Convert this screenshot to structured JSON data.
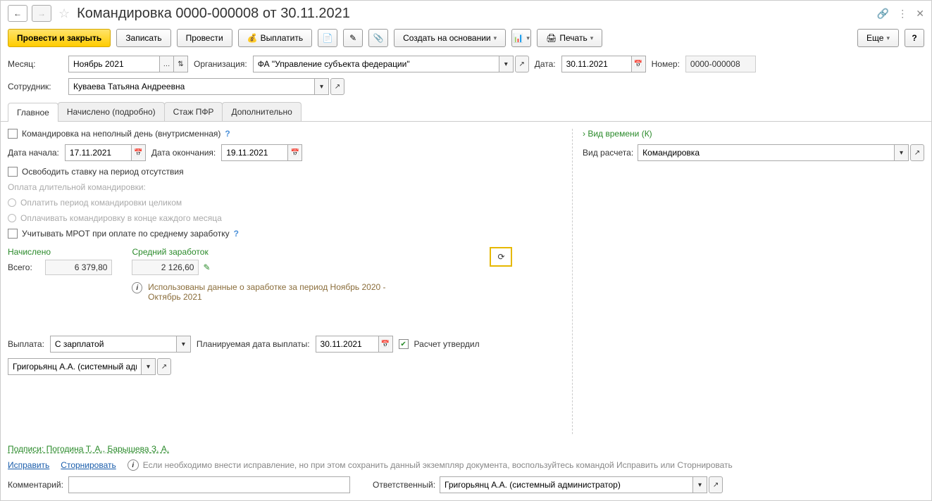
{
  "title": "Командировка 0000-000008 от 30.11.2021",
  "toolbar": {
    "post_close": "Провести и закрыть",
    "save": "Записать",
    "post": "Провести",
    "pay": "Выплатить",
    "create_based": "Создать на основании",
    "print": "Печать",
    "more": "Еще"
  },
  "fields": {
    "month_label": "Месяц:",
    "month_value": "Ноябрь 2021",
    "org_label": "Организация:",
    "org_value": "ФА \"Управление субъекта федерации\"",
    "date_label": "Дата:",
    "date_value": "30.11.2021",
    "number_label": "Номер:",
    "number_value": "0000-000008",
    "employee_label": "Сотрудник:",
    "employee_value": "Куваева Татьяна Андреевна"
  },
  "tabs": {
    "main": "Главное",
    "detail": "Начислено (подробно)",
    "pfr": "Стаж ПФР",
    "extra": "Дополнительно"
  },
  "main": {
    "partial_day": "Командировка на неполный день (внутрисменная)",
    "start_label": "Дата начала:",
    "start_value": "17.11.2021",
    "end_label": "Дата окончания:",
    "end_value": "19.11.2021",
    "free_rate": "Освободить ставку на период отсутствия",
    "long_trip_header": "Оплата длительной командировки:",
    "long_opt1": "Оплатить период командировки целиком",
    "long_opt2": "Оплачивать командировку в конце каждого месяца",
    "mrot": "Учитывать МРОТ при оплате по среднему заработку",
    "accrued_header": "Начислено",
    "total_label": "Всего:",
    "total_value": "6 379,80",
    "avg_header": "Средний заработок",
    "avg_value": "2 126,60",
    "info_note": "Использованы данные о заработке за период Ноябрь 2020 - Октябрь 2021",
    "payout_label": "Выплата:",
    "payout_value": "С зарплатой",
    "plan_date_label": "Планируемая дата выплаты:",
    "plan_date_value": "30.11.2021",
    "approved_label": "Расчет утвердил",
    "approver_value": "Григорьянц А.А. (системный адми"
  },
  "right": {
    "time_type": "Вид времени (К)",
    "calc_type_label": "Вид расчета:",
    "calc_type_value": "Командировка"
  },
  "footer": {
    "signatures": "Подписи: Погодина Т. А., Барышева З. А.",
    "fix": "Исправить",
    "storno": "Сторнировать",
    "hint": "Если необходимо внести исправление, но при этом сохранить данный экземпляр документа, воспользуйтесь командой Исправить или Сторнировать",
    "comment_label": "Комментарий:",
    "responsible_label": "Ответственный:",
    "responsible_value": "Григорьянц А.А. (системный администратор)"
  }
}
